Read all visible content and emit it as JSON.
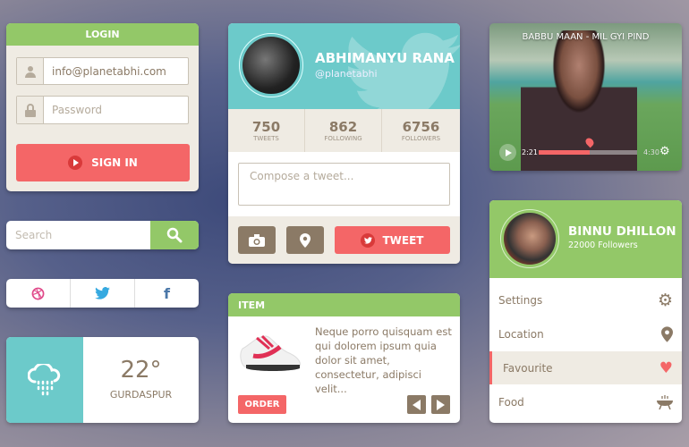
{
  "login": {
    "title": "LOGIN",
    "email_value": "info@planetabhi.com",
    "password_placeholder": "Password",
    "sign_in": "SIGN IN"
  },
  "search": {
    "placeholder": "Search"
  },
  "social": {
    "icons": [
      "dribbble-icon",
      "twitter-icon",
      "facebook-icon"
    ],
    "facebook_glyph": "f"
  },
  "weather": {
    "temp": "22°",
    "city": "GURDASPUR",
    "icon": "rain-cloud-icon"
  },
  "twitter": {
    "name": "ABHIMANYU RANA",
    "handle": "@planetabhi",
    "stats": [
      {
        "value": "750",
        "label": "TWEETS"
      },
      {
        "value": "862",
        "label": "FOLLOWING"
      },
      {
        "value": "6756",
        "label": "FOLLOWERS"
      }
    ],
    "compose_placeholder": "Compose a tweet...",
    "tweet": "TWEET"
  },
  "item": {
    "title": "ITEM",
    "description": "Neque porro quisquam est qui dolorem ipsum quia dolor sit amet, consectetur, adipisci velit...",
    "order": "ORDER"
  },
  "video": {
    "title": "BABBU MAAN - MIL GYI PIND",
    "current": "2:21",
    "duration": "4:30",
    "progress": 0.52
  },
  "profile": {
    "name": "BINNU DHILLON",
    "followers": "22000 Followers",
    "menu": [
      {
        "label": "Settings",
        "icon": "gear-icon"
      },
      {
        "label": "Location",
        "icon": "location-pin-icon"
      },
      {
        "label": "Favourite",
        "icon": "heart-icon",
        "active": true
      },
      {
        "label": "Food",
        "icon": "food-bowl-icon"
      }
    ]
  },
  "colors": {
    "green": "#93c868",
    "teal": "#6ccaca",
    "red": "#f46667",
    "brown": "#8b7a66",
    "beige": "#efebe3"
  }
}
